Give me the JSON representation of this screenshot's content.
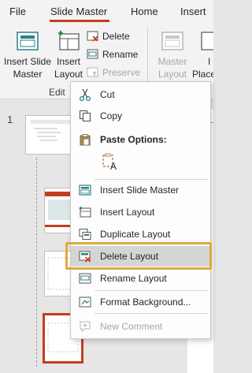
{
  "tabs": {
    "file": "File",
    "slide_master": "Slide Master",
    "home": "Home",
    "insert": "Insert"
  },
  "ribbon": {
    "insert_slide_master": [
      "Insert Slide",
      "Master"
    ],
    "insert_layout": [
      "Insert",
      "Layout"
    ],
    "delete": "Delete",
    "rename": "Rename",
    "preserve": "Preserve",
    "group_label": "Edit",
    "master_layout": [
      "Master",
      "Layout"
    ],
    "insert_placeholder": [
      "I",
      "Placel"
    ]
  },
  "pane": {
    "slide_number": "1"
  },
  "context_menu": {
    "cut": "Cut",
    "copy": "Copy",
    "paste_options": "Paste Options:",
    "insert_slide_master": "Insert Slide Master",
    "insert_layout": "Insert Layout",
    "duplicate_layout": "Duplicate Layout",
    "delete_layout": "Delete Layout",
    "rename_layout": "Rename Layout",
    "format_background": "Format Background...",
    "new_comment": "New Comment"
  },
  "colors": {
    "accent": "#c43e1c",
    "highlight": "#e0a93f",
    "icon_teal": "#2e7d8c"
  }
}
